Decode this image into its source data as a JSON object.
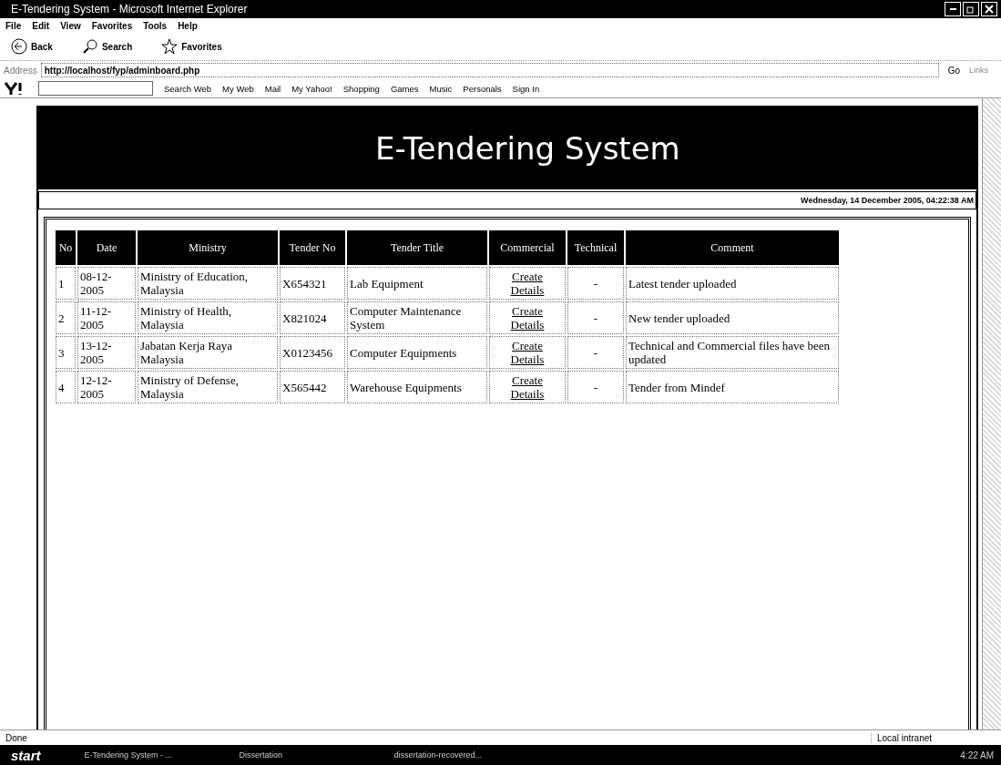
{
  "window": {
    "title": "E-Tendering System - Microsoft Internet Explorer"
  },
  "menu": [
    "File",
    "Edit",
    "View",
    "Favorites",
    "Tools",
    "Help"
  ],
  "toolbar": [
    {
      "kind": "back",
      "label": "Back"
    },
    {
      "kind": "search",
      "label": "Search"
    },
    {
      "kind": "favorites",
      "label": "Favorites"
    }
  ],
  "address": {
    "label": "Address",
    "value": "http://localhost/fyp/adminboard.php",
    "go": "Go",
    "links": "Links"
  },
  "yahoo_toolbar": [
    "Search Web",
    "My Web",
    "Mail",
    "My Yahoo!",
    "Shopping",
    "Games",
    "Music",
    "Personals",
    "Sign In"
  ],
  "page": {
    "title": "E-Tendering System",
    "datetime": "Wednesday, 14 December 2005, 04:22:38 AM",
    "table": {
      "columns": [
        "No",
        "Date",
        "Ministry",
        "Tender No",
        "Tender Title",
        "Commercial",
        "Technical",
        "Comment"
      ],
      "rows": [
        {
          "no": "1",
          "date": "08-12-2005",
          "ministry": "Ministry of Education, Malaysia",
          "tender_no": "X654321",
          "title": "Lab Equipment",
          "commercial": [
            "Create",
            "Details"
          ],
          "technical": "-",
          "comment": "Latest tender uploaded"
        },
        {
          "no": "2",
          "date": "11-12-2005",
          "ministry": "Ministry of Health, Malaysia",
          "tender_no": "X821024",
          "title": "Computer Maintenance System",
          "commercial": [
            "Create",
            "Details"
          ],
          "technical": "-",
          "comment": "New tender uploaded"
        },
        {
          "no": "3",
          "date": "13-12-2005",
          "ministry": "Jabatan Kerja Raya Malaysia",
          "tender_no": "X0123456",
          "title": "Computer Equipments",
          "commercial": [
            "Create",
            "Details"
          ],
          "technical": "-",
          "comment": "Technical and Commercial files have been updated"
        },
        {
          "no": "4",
          "date": "12-12-2005",
          "ministry": "Ministry of Defense, Malaysia",
          "tender_no": "X565442",
          "title": "Warehouse Equipments",
          "commercial": [
            "Create",
            "Details"
          ],
          "technical": "-",
          "comment": "Tender from Mindef"
        }
      ]
    }
  },
  "status_bar": {
    "text": "Done",
    "zone": "Local intranet"
  },
  "taskbar": {
    "start": "start",
    "items": [
      "E-Tendering System - ...",
      "Dissertation",
      "dissertation-recovered..."
    ],
    "clock": "4:22 AM"
  }
}
